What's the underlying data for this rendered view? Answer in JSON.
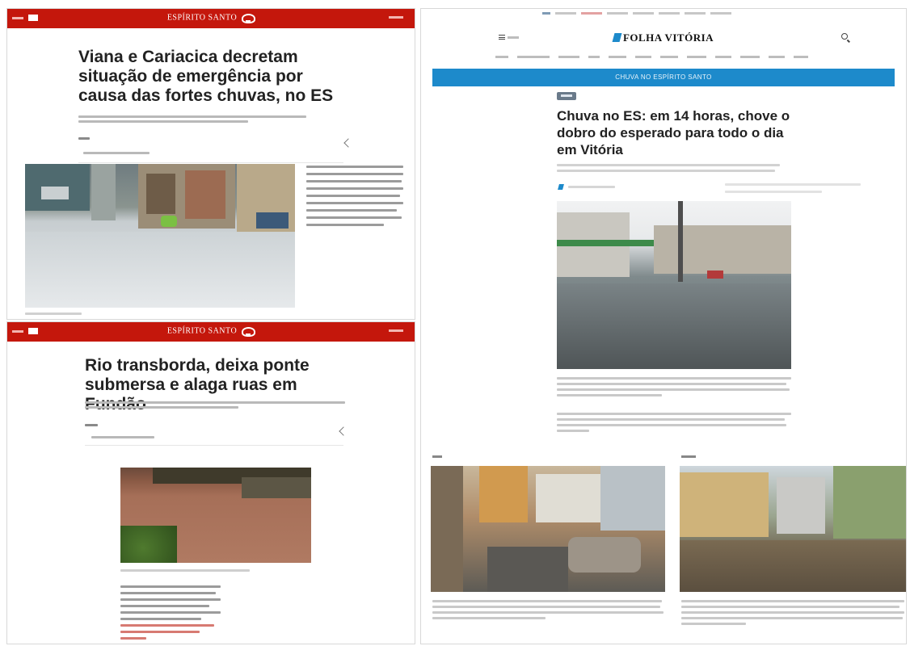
{
  "panel_g1_viana": {
    "section": "ESPÍRITO SANTO",
    "title": "Viana e Cariacica decretam situação de emergência por causa das fortes chuvas, no ES"
  },
  "panel_g1_fundao": {
    "section": "ESPÍRITO SANTO",
    "title": "Rio transborda, deixa ponte submersa e alaga ruas em Fundão"
  },
  "panel_folha": {
    "logo": "FOLHA VITÓRIA",
    "banner": "CHUVA NO ESPÍRITO SANTO",
    "title": "Chuva no ES: em 14 horas, chove o dobro do esperado para todo o dia em Vitória"
  },
  "colors": {
    "g1_red": "#c4170c",
    "folha_blue": "#1d8acb"
  },
  "icons": [
    "tv-icon",
    "share-icon",
    "menu-icon",
    "search-icon",
    "logo-mark-icon"
  ]
}
